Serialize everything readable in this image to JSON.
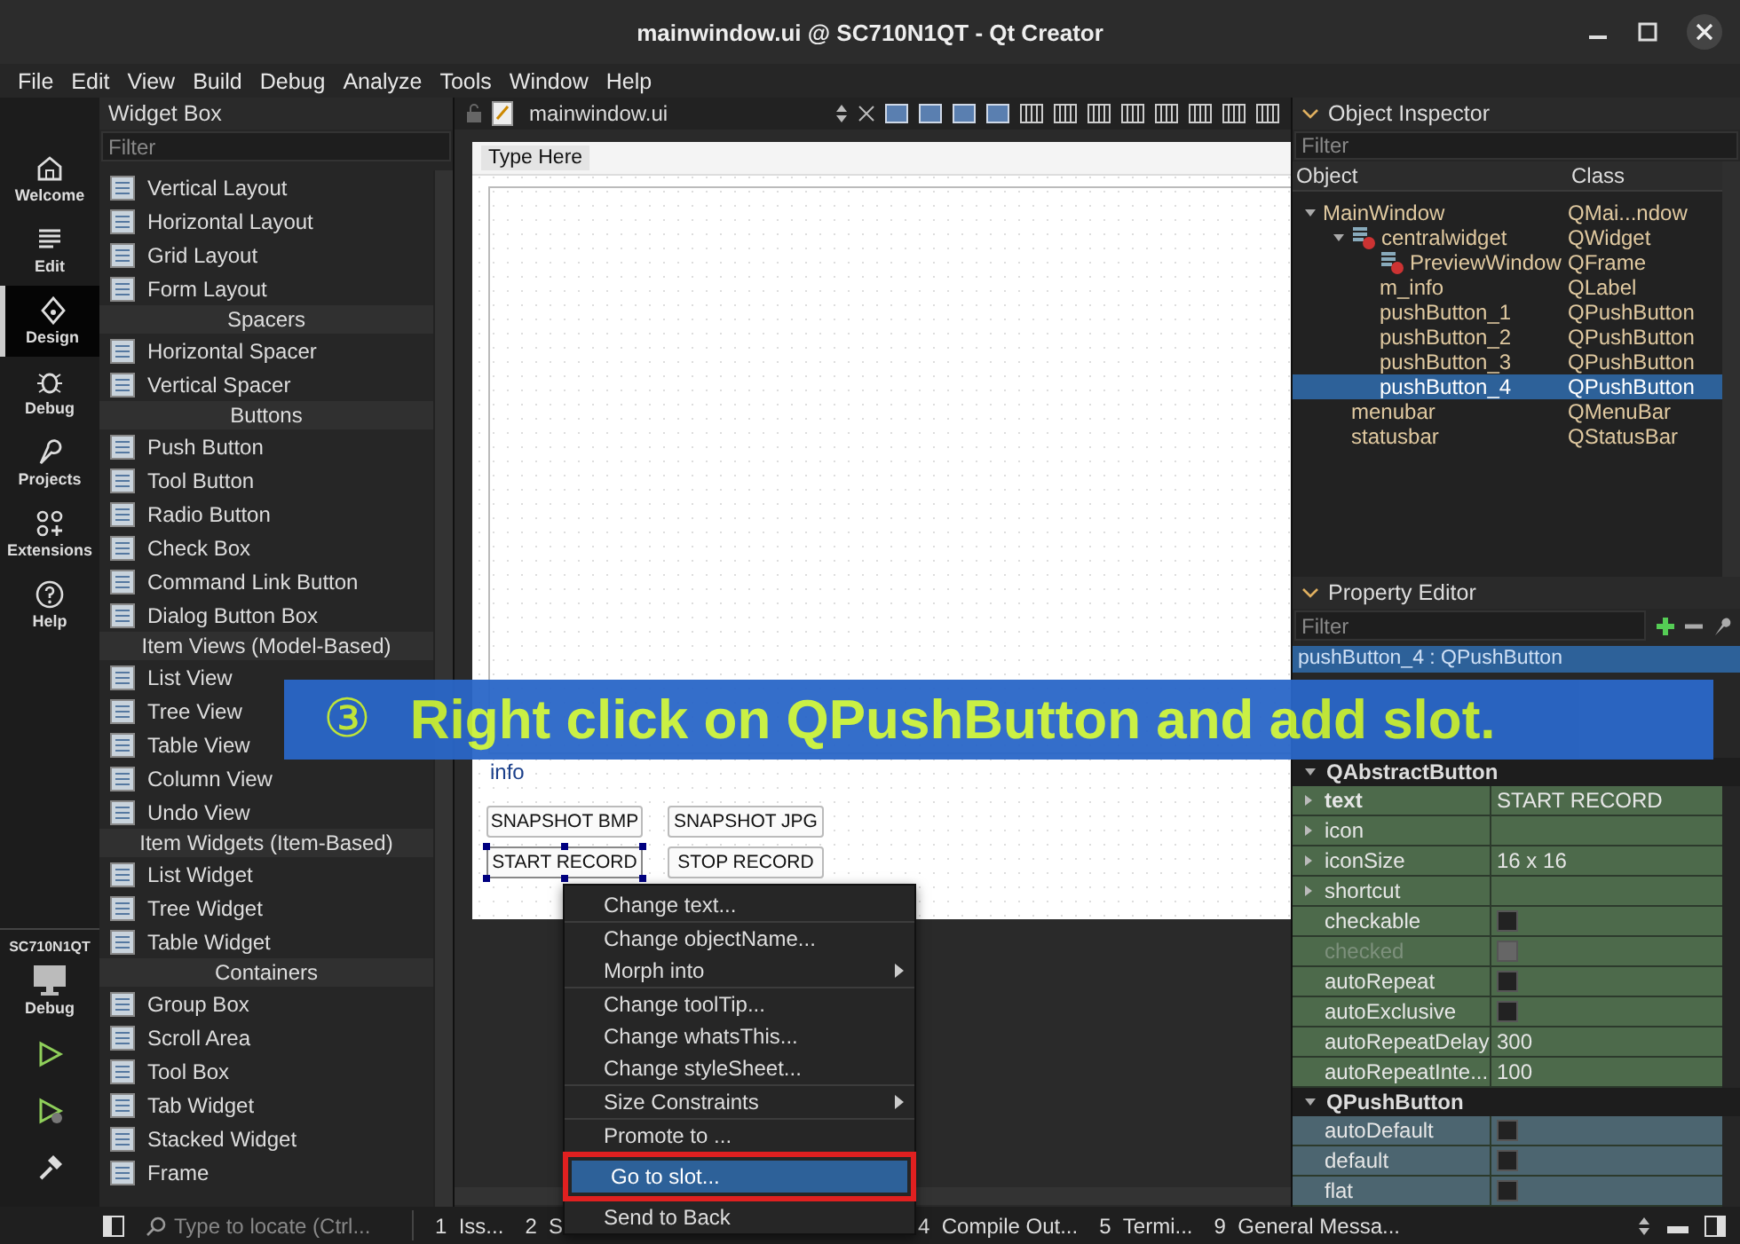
{
  "window": {
    "title": "mainwindow.ui @ SC710N1QT - Qt Creator"
  },
  "menu": [
    "File",
    "Edit",
    "View",
    "Build",
    "Debug",
    "Analyze",
    "Tools",
    "Window",
    "Help"
  ],
  "modes": [
    {
      "label": "Welcome",
      "kind": "home",
      "selected": false
    },
    {
      "label": "Edit",
      "kind": "edit",
      "selected": false
    },
    {
      "label": "Design",
      "kind": "design",
      "selected": true
    },
    {
      "label": "Debug",
      "kind": "debug",
      "selected": false
    },
    {
      "label": "Projects",
      "kind": "projects",
      "selected": false
    },
    {
      "label": "Extensions",
      "kind": "extensions",
      "selected": false
    },
    {
      "label": "Help",
      "kind": "help",
      "selected": false
    }
  ],
  "kit": {
    "name": "SC710N1QT",
    "mode": "Debug"
  },
  "widget_box": {
    "title": "Widget Box",
    "filter_placeholder": "Filter",
    "groups": [
      {
        "items": [
          "Vertical Layout",
          "Horizontal Layout",
          "Grid Layout",
          "Form Layout"
        ]
      },
      {
        "title": "Spacers",
        "items": [
          "Horizontal Spacer",
          "Vertical Spacer"
        ]
      },
      {
        "title": "Buttons",
        "items": [
          "Push Button",
          "Tool Button",
          "Radio Button",
          "Check Box",
          "Command Link Button",
          "Dialog Button Box"
        ]
      },
      {
        "title": "Item Views (Model-Based)",
        "items": [
          "List View",
          "Tree View",
          "Table View",
          "Column View",
          "Undo View"
        ]
      },
      {
        "title": "Item Widgets (Item-Based)",
        "items": [
          "List Widget",
          "Tree Widget",
          "Table Widget"
        ]
      },
      {
        "title": "Containers",
        "items": [
          "Group Box",
          "Scroll Area",
          "Tool Box",
          "Tab Widget",
          "Stacked Widget",
          "Frame"
        ]
      }
    ]
  },
  "editor": {
    "file_name": "mainwindow.ui",
    "form": {
      "menu_placeholder": "Type Here",
      "label": "info",
      "buttons": [
        {
          "text": "SNAPSHOT BMP",
          "selected": false
        },
        {
          "text": "SNAPSHOT JPG",
          "selected": false
        },
        {
          "text": "START RECORD",
          "selected": true
        },
        {
          "text": "STOP RECORD",
          "selected": false
        }
      ]
    }
  },
  "context_menu": [
    {
      "label": "Change text...",
      "separator_before": false,
      "submenu": false,
      "selected": false
    },
    {
      "label": "Change objectName...",
      "separator_before": true,
      "submenu": false,
      "selected": false
    },
    {
      "label": "Morph into",
      "separator_before": false,
      "submenu": true,
      "selected": false
    },
    {
      "label": "Change toolTip...",
      "separator_before": true,
      "submenu": false,
      "selected": false
    },
    {
      "label": "Change whatsThis...",
      "separator_before": false,
      "submenu": false,
      "selected": false
    },
    {
      "label": "Change styleSheet...",
      "separator_before": false,
      "submenu": false,
      "selected": false
    },
    {
      "label": "Size Constraints",
      "separator_before": true,
      "submenu": true,
      "selected": false
    },
    {
      "label": "Promote to ...",
      "separator_before": true,
      "submenu": false,
      "selected": false
    },
    {
      "label": "Go to slot...",
      "separator_before": false,
      "submenu": false,
      "selected": true
    },
    {
      "label": "Send to Back",
      "separator_before": false,
      "submenu": false,
      "selected": false
    }
  ],
  "object_inspector": {
    "title": "Object Inspector",
    "filter_placeholder": "Filter",
    "columns": [
      "Object",
      "Class"
    ],
    "tree": [
      {
        "name": "MainWindow",
        "class": "QMai...ndow",
        "layout_icon": false,
        "expanded": true,
        "selected": false,
        "children": [
          {
            "name": "centralwidget",
            "class": "QWidget",
            "layout_icon": true,
            "expanded": true,
            "selected": false,
            "children": [
              {
                "name": "PreviewWindow",
                "class": "QFrame",
                "layout_icon": true,
                "selected": false
              },
              {
                "name": "m_info",
                "class": "QLabel",
                "layout_icon": false,
                "selected": false
              },
              {
                "name": "pushButton_1",
                "class": "QPushButton",
                "layout_icon": false,
                "selected": false
              },
              {
                "name": "pushButton_2",
                "class": "QPushButton",
                "layout_icon": false,
                "selected": false
              },
              {
                "name": "pushButton_3",
                "class": "QPushButton",
                "layout_icon": false,
                "selected": false
              },
              {
                "name": "pushButton_4",
                "class": "QPushButton",
                "layout_icon": false,
                "selected": true
              }
            ]
          },
          {
            "name": "menubar",
            "class": "QMenuBar",
            "layout_icon": false,
            "selected": false
          },
          {
            "name": "statusbar",
            "class": "QStatusBar",
            "layout_icon": false,
            "selected": false
          }
        ]
      }
    ]
  },
  "property_editor": {
    "title": "Property Editor",
    "filter_placeholder": "Filter",
    "object_label": "pushButton_4 : QPushButton",
    "groups": [
      {
        "title": "QAbstractButton",
        "color": "#4d6a4b",
        "rows": [
          {
            "name": "text",
            "kind": "text",
            "value": "START RECORD",
            "expandable": true,
            "modified": true,
            "disabled": false
          },
          {
            "name": "icon",
            "kind": "text",
            "value": "",
            "expandable": true,
            "modified": false,
            "disabled": false
          },
          {
            "name": "iconSize",
            "kind": "text",
            "value": "16 x 16",
            "expandable": true,
            "modified": false,
            "disabled": false
          },
          {
            "name": "shortcut",
            "kind": "text",
            "value": "",
            "expandable": true,
            "modified": false,
            "disabled": false
          },
          {
            "name": "checkable",
            "kind": "checkbox",
            "checked": false,
            "expandable": false,
            "modified": false,
            "disabled": false
          },
          {
            "name": "checked",
            "kind": "checkbox",
            "checked": false,
            "expandable": false,
            "modified": false,
            "disabled": true
          },
          {
            "name": "autoRepeat",
            "kind": "checkbox",
            "checked": false,
            "expandable": false,
            "modified": false,
            "disabled": false
          },
          {
            "name": "autoExclusive",
            "kind": "checkbox",
            "checked": false,
            "expandable": false,
            "modified": false,
            "disabled": false
          },
          {
            "name": "autoRepeatDelay",
            "kind": "text",
            "value": "300",
            "expandable": false,
            "modified": false,
            "disabled": false
          },
          {
            "name": "autoRepeatInte...",
            "kind": "text",
            "value": "100",
            "expandable": false,
            "modified": false,
            "disabled": false
          }
        ]
      },
      {
        "title": "QPushButton",
        "color": "#4c6570",
        "rows": [
          {
            "name": "autoDefault",
            "kind": "checkbox",
            "checked": false,
            "expandable": false,
            "modified": false,
            "disabled": false
          },
          {
            "name": "default",
            "kind": "checkbox",
            "checked": false,
            "expandable": false,
            "modified": false,
            "disabled": false
          },
          {
            "name": "flat",
            "kind": "checkbox",
            "checked": false,
            "expandable": false,
            "modified": false,
            "disabled": false
          }
        ]
      }
    ]
  },
  "status_bar": {
    "locate_placeholder": "Type to locate (Ctrl...",
    "panes": [
      {
        "number": "1",
        "label": "Iss..."
      },
      {
        "number": "2",
        "label": "S"
      },
      {
        "number": "4",
        "label": "Compile Out..."
      },
      {
        "number": "5",
        "label": "Termi..."
      },
      {
        "number": "9",
        "label": "General Messa..."
      }
    ]
  },
  "banner": {
    "number": "③",
    "text": "Right click on QPushButton and add slot."
  }
}
